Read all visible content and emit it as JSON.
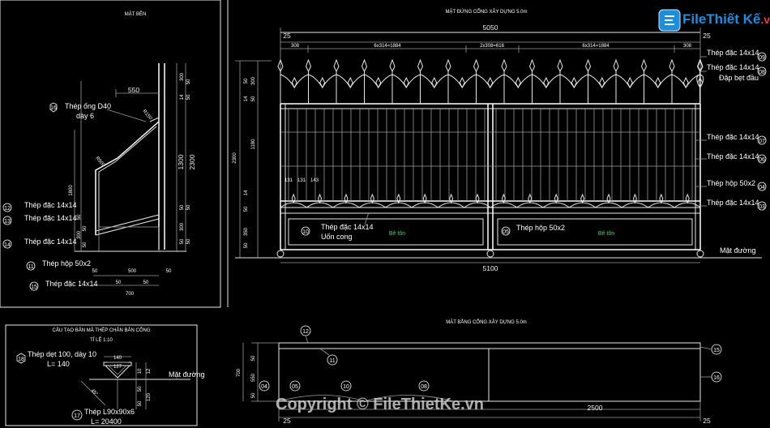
{
  "panels": {
    "side_section_title": "MẶT BÊN",
    "elevation_title": "MẶT ĐỨNG CỔNG XÂY DỰNG 5.0m",
    "plan_title": "MẶT BẰNG CỔNG XÂY DỰNG 5.0m",
    "detail_title": "CẤU TẠO BẢN MÃ THÉP CHÂN BẢN CỔNG",
    "detail_scale": "TỈ LỆ 1:10"
  },
  "side_section": {
    "dims_top": [
      "550",
      "300",
      "50",
      "14",
      "50"
    ],
    "dims_right": [
      "1300",
      "2300",
      "50",
      "50",
      "300",
      "50",
      "50"
    ],
    "dims_bottom": [
      "50",
      "500",
      "50",
      "50",
      "50",
      "700"
    ],
    "dims_left": [
      "1800",
      "50",
      "50",
      "300",
      "50"
    ],
    "incline": [
      "R150",
      "R500"
    ],
    "labels": [
      {
        "tag": "16",
        "text": "Thép ống D40\ndày 6"
      },
      {
        "tag": "12",
        "text": "Thép đặc 14x14"
      },
      {
        "tag": "13",
        "text": "Thép đặc 14x14"
      },
      {
        "tag": "14",
        "text": "Thép đặc 14x14"
      },
      {
        "tag": "11",
        "text": "Thép hộp 50x2"
      },
      {
        "tag": "15",
        "text": "Thép đặc 14x14"
      }
    ]
  },
  "elevation": {
    "overall_top": "5050",
    "edge_top": [
      "25",
      "25"
    ],
    "segments_top": [
      "308",
      "6x314=1884",
      "2x308=616",
      "6x314=1884",
      "308"
    ],
    "dims_left": [
      "300",
      "50",
      "14",
      "50",
      "1180",
      "2300",
      "14",
      "50",
      "350",
      "50"
    ],
    "dims_mid": [
      "131",
      "131",
      "143"
    ],
    "overall_bottom": "5100",
    "ground": "Mặt đường",
    "panel_labels": [
      "Bê tôn",
      "Bê tôn"
    ],
    "labels_left": [
      {
        "tag": "10",
        "text": "Thép đặc 14x14\nUốn cong"
      },
      {
        "tag": "05",
        "text": "Thép hộp 50x2"
      }
    ],
    "labels_right": [
      {
        "tag": "09",
        "text": "Thép đặc 14x14"
      },
      {
        "tag": "08",
        "text": "Thép đặc 14x14\nĐập bẹt đầu"
      },
      {
        "tag": "07",
        "text": "Thép đặc 14x14"
      },
      {
        "tag": "06",
        "text": "Thép đặc 14x14"
      },
      {
        "tag": "04",
        "text": "Thép hộp 50x2"
      },
      {
        "tag": "03",
        "text": "Thép đặc 14x14"
      }
    ]
  },
  "detail": {
    "labels": [
      {
        "tag": "18",
        "text": "Thép dẹt 100, dày 10\nL= 140"
      },
      {
        "tag": "17",
        "text": "Thép L90x90x6\nL= 20400"
      }
    ],
    "dims": [
      "140",
      "127",
      "10",
      "12",
      "50",
      "120",
      "50"
    ],
    "ground": "Mặt đường",
    "incline": "45°"
  },
  "plan": {
    "dims_left": [
      "50",
      "700",
      "550",
      "50"
    ],
    "overall_bottom": "2500",
    "edge": [
      "25",
      "25"
    ],
    "tags": [
      "12",
      "11",
      "15",
      "16",
      "04",
      "05",
      "10",
      "08"
    ]
  },
  "watermark": {
    "logo_word1": "File",
    "logo_word2": "Thiết Kế",
    "logo_suffix": ".vn",
    "copyright": "Copyright © FileThietKe.vn"
  },
  "colors": {
    "background": "#000000",
    "lines": "#e8e8e8",
    "green_text": "#2ee84f",
    "logo_blue": "#1a8fe0"
  }
}
